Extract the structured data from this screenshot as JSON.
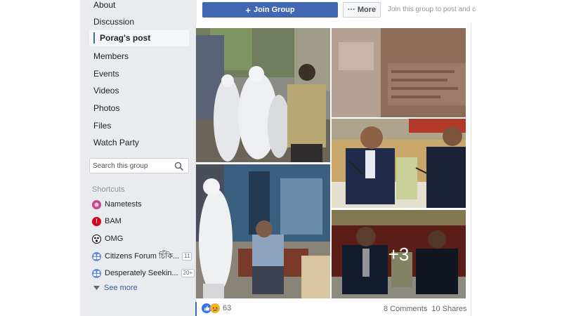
{
  "sidebar": {
    "items": [
      {
        "label": "About"
      },
      {
        "label": "Discussion"
      },
      {
        "label": "Porag's post"
      },
      {
        "label": "Members"
      },
      {
        "label": "Events"
      },
      {
        "label": "Videos"
      },
      {
        "label": "Photos"
      },
      {
        "label": "Files"
      },
      {
        "label": "Watch Party"
      }
    ],
    "search_placeholder": "Search this group",
    "shortcuts_title": "Shortcuts",
    "shortcuts": [
      {
        "label": "Nametests",
        "icon": "nametests-icon",
        "color": "#c44b8f"
      },
      {
        "label": "BAM",
        "icon": "bam-icon",
        "color": "#d0021b"
      },
      {
        "label": "OMG",
        "icon": "omg-icon",
        "color": "#000000"
      },
      {
        "label": "Citizens Forum চিঁকি...",
        "icon": "group-icon",
        "color": "#6a8ed8",
        "badge": "11"
      },
      {
        "label": "Desperately Seekin...",
        "icon": "group-icon",
        "color": "#6a8ed8",
        "badge": "20+"
      }
    ],
    "see_more": "See more"
  },
  "header": {
    "join_label": "Join Group",
    "more_label": "More",
    "join_hint": "Join this group to post and com"
  },
  "post": {
    "more_photos": "+3",
    "reaction_count": "63",
    "comments": "8 Comments",
    "shares": "10 Shares"
  },
  "colors": {
    "accent": "#4267b2",
    "sidebar_bg": "#e9ebee",
    "link": "#385898"
  }
}
